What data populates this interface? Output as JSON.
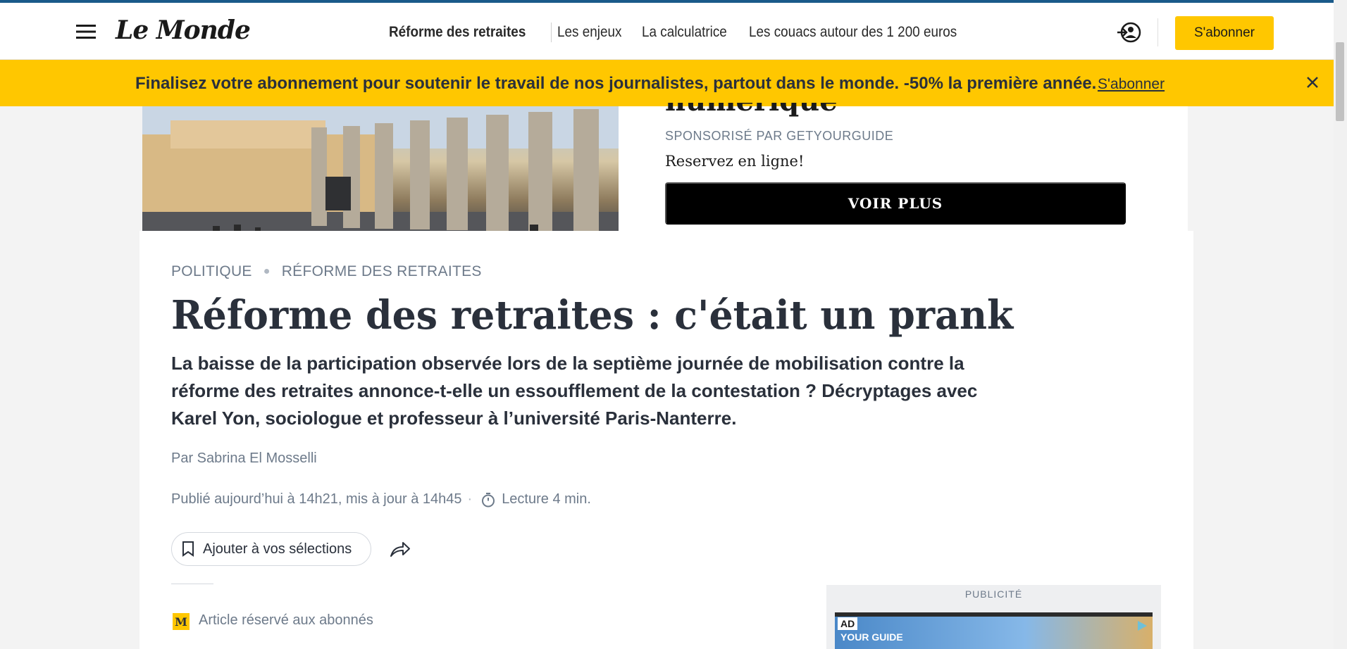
{
  "header": {
    "logo": "Le Monde",
    "nav": [
      {
        "label": "Réforme des retraites"
      },
      {
        "label": "Les enjeux"
      },
      {
        "label": "La calculatrice"
      },
      {
        "label": "Les couacs autour des 1 200 euros"
      }
    ],
    "subscribe_label": "S'abonner"
  },
  "promo": {
    "text": "Finalisez votre abonnement pour soutenir le travail de nos journalistes, partout dans le monde. -50% la première année.",
    "link": "S'abonner"
  },
  "ad": {
    "title_fragment": "numérique",
    "sponsor": "SPONSORISÉ PAR GETYOURGUIDE",
    "tagline": "Reservez en ligne!",
    "cta": "VOIR PLUS"
  },
  "article": {
    "breadcrumb": [
      "POLITIQUE",
      "RÉFORME DES RETRAITES"
    ],
    "headline": "Réforme des retraites : c'était un prank",
    "standfirst": "La baisse de la participation observée lors de la septième journée de mobilisation contre la réforme des retraites annonce-t-elle un essoufflement de la contestation ? Décryptages avec Karel Yon, sociologue et professeur à l’université Paris-Nanterre.",
    "byline": "Par Sabrina El Mosselli",
    "published": "Publié aujourd’hui à 14h21, mis à jour à 14h45",
    "reading_time": "Lecture 4 min.",
    "save_label": "Ajouter à vos sélections",
    "premium_badge": "M",
    "premium_text": "Article réservé aux abonnés"
  },
  "side_ad": {
    "label": "PUBLICITÉ",
    "tag": "AD",
    "brand": "YOUR GUIDE"
  },
  "colors": {
    "accent_yellow": "#ffc700",
    "text_dark": "#2a303b",
    "text_muted": "#6d7a8a"
  },
  "icons": [
    "hamburger-menu-icon",
    "login-icon",
    "close-icon",
    "timer-icon",
    "bookmark-icon",
    "share-icon",
    "adchoices-icon"
  ]
}
